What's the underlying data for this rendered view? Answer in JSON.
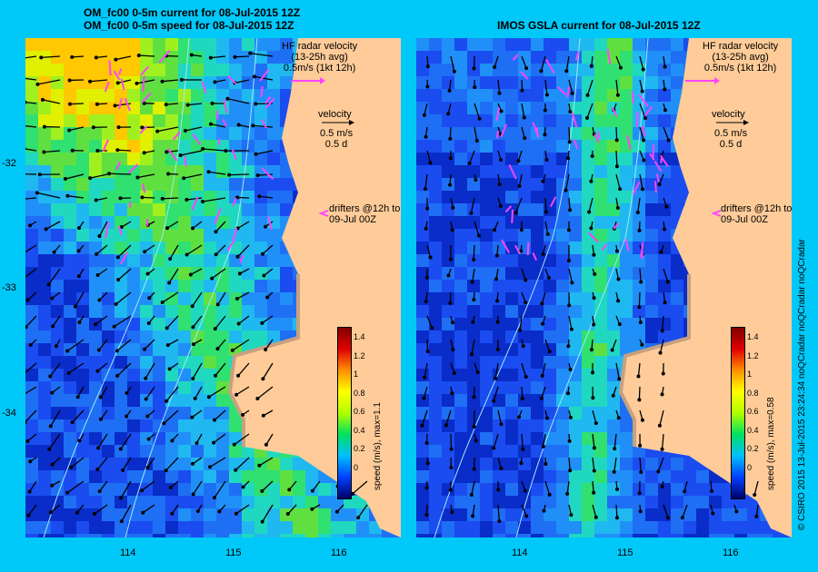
{
  "panels": {
    "left": {
      "title_line1": "OM_fc00 0-5m current for 08-Jul-2015 12Z",
      "title_line2": "OM_fc00 0-5m speed for 08-Jul-2015 12Z",
      "colorbar_title": "speed (m/s), max=1.1"
    },
    "right": {
      "title_line1": "IMOS GSLA current for 08-Jul-2015 12Z",
      "colorbar_title": "speed (m/s), max=0.58"
    }
  },
  "legend": {
    "hf_radar_line1": "HF radar velocity",
    "hf_radar_line2": "(13-25h avg)",
    "hf_radar_line3": "0.5m/s (1kt 12h)",
    "velocity_label": "velocity",
    "velocity_scale1": "0.5 m/s",
    "velocity_scale2": "0.5 d",
    "drifters_line1": "drifters @12h to",
    "drifters_line2": "09-Jul 00Z"
  },
  "axes": {
    "y_ticks": [
      "-32",
      "-33",
      "-34"
    ],
    "x_ticks": [
      "114",
      "115",
      "116"
    ]
  },
  "colorbar": {
    "ticks": [
      "1.4",
      "1.2",
      "1",
      "0.8",
      "0.6",
      "0.4",
      "0.2",
      "0"
    ],
    "colors": [
      "#00006a",
      "#0040ff",
      "#00c0ff",
      "#00e060",
      "#b0ff00",
      "#ffff00",
      "#ff9000",
      "#e00000",
      "#800000"
    ]
  },
  "credit": "© CSIRO 2015   13-Jul-2015 23:24:34 noQCradar noQCradar noQCradar",
  "colors": {
    "background": "#00c8f8",
    "land": "#ffcc99",
    "radar_arrows": "#ff44ff",
    "model_arrows": "#000000"
  }
}
